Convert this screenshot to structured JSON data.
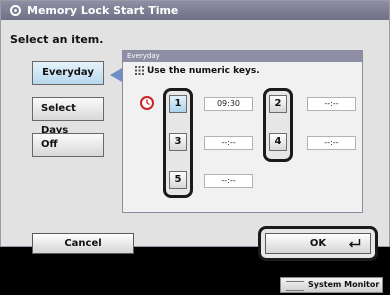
{
  "window": {
    "title": "Memory Lock Start Time"
  },
  "prompt": "Select an item.",
  "items": [
    {
      "label": "Everyday",
      "selected": true
    },
    {
      "label": "Select Days",
      "selected": false
    },
    {
      "label": "Off",
      "selected": false
    }
  ],
  "group": {
    "title": "Everyday",
    "hint": "Use the numeric keys."
  },
  "slots": [
    {
      "key": "1",
      "value": "09:30",
      "selected": true
    },
    {
      "key": "2",
      "value": "--:--",
      "selected": false
    },
    {
      "key": "3",
      "value": "--:--",
      "selected": false
    },
    {
      "key": "4",
      "value": "--:--",
      "selected": false
    },
    {
      "key": "5",
      "value": "--:--",
      "selected": false
    }
  ],
  "buttons": {
    "cancel": "Cancel",
    "ok": "OK"
  },
  "status": {
    "system_monitor": "System Monitor"
  },
  "colors": {
    "title_bar": "#7f7f96",
    "selected": "#b8d8ec",
    "pointer": "#6d8fc6",
    "ring": "#1a1a1a"
  }
}
